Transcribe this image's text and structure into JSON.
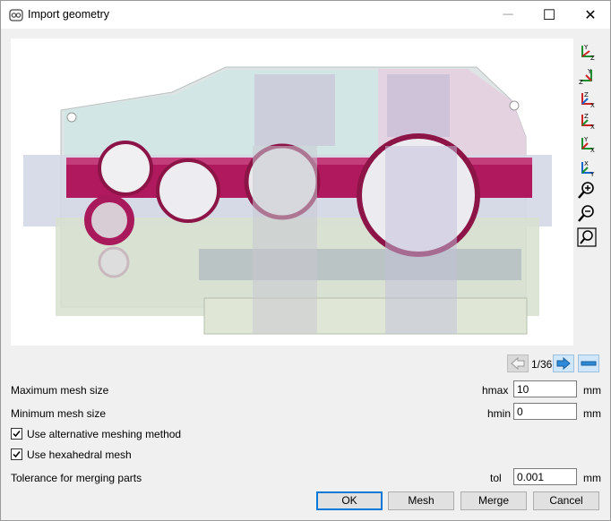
{
  "window": {
    "title": "Import geometry",
    "minimize": "─",
    "maximize": "☐",
    "close": "✕"
  },
  "view_toolbar": [
    "view-y-z-icon",
    "view-z-y-icon",
    "view-z-x-icon",
    "view-x-z-icon",
    "view-y-x-icon",
    "view-x-y-icon",
    "zoom-in-icon",
    "zoom-out-icon",
    "zoom-fit-icon"
  ],
  "pager": {
    "text": "1/36"
  },
  "params": {
    "max_mesh": {
      "label": "Maximum mesh size",
      "symbol": "hmax",
      "value": "10",
      "unit": "mm"
    },
    "min_mesh": {
      "label": "Minimum mesh size",
      "symbol": "hmin",
      "value": "0",
      "unit": "mm"
    },
    "alt_method": {
      "label": "Use alternative meshing method",
      "checked": true
    },
    "hex_mesh": {
      "label": "Use hexahedral mesh",
      "checked": true
    },
    "tolerance": {
      "label": "Tolerance for merging parts",
      "symbol": "tol",
      "value": "0.001",
      "unit": "mm"
    }
  },
  "buttons": {
    "ok": "OK",
    "mesh": "Mesh",
    "merge": "Merge",
    "cancel": "Cancel"
  },
  "colors": {
    "highlight": "#b0195e",
    "accent": "#0078d7",
    "arrow": "#2c8ad8"
  }
}
